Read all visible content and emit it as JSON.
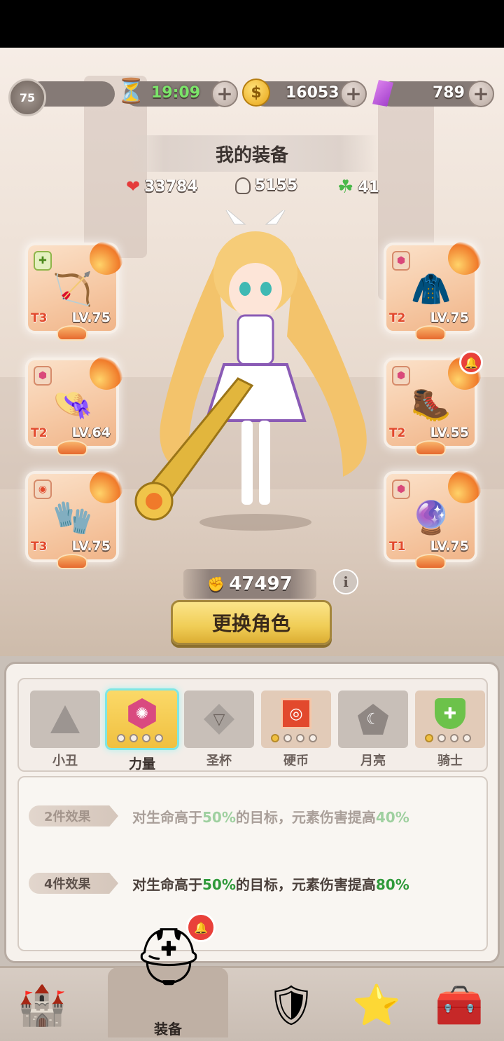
{
  "player": {
    "level": "75"
  },
  "resources": {
    "timer": "19:09",
    "coins": "16053",
    "gems": "789"
  },
  "page_title": "我的装备",
  "stats": {
    "hp": "33784",
    "attack": "5155",
    "luck": "41"
  },
  "equipment": {
    "left": [
      {
        "icon": "crossbow",
        "tier": "T3",
        "level": "LV.75"
      },
      {
        "icon": "feathered-hat",
        "tier": "T2",
        "level": "LV.64"
      },
      {
        "icon": "gauntlet",
        "tier": "T3",
        "level": "LV.75"
      }
    ],
    "right": [
      {
        "icon": "cloak",
        "tier": "T2",
        "level": "LV.75"
      },
      {
        "icon": "armored-boots",
        "tier": "T2",
        "level": "LV.55",
        "alert": true
      },
      {
        "icon": "crystal-amulet",
        "tier": "T1",
        "level": "LV.75"
      }
    ]
  },
  "combat_power": "47497",
  "switch_button": "更换角色",
  "set_tabs": [
    {
      "label": "小丑",
      "icon": "drop-triangle"
    },
    {
      "label": "力量",
      "icon": "pink-hexagon",
      "active": true,
      "dots": 4
    },
    {
      "label": "圣杯",
      "icon": "chalice-diamond"
    },
    {
      "label": "硬币",
      "icon": "red-square",
      "dots": 4,
      "dots_on": 1
    },
    {
      "label": "月亮",
      "icon": "moon-pentagon"
    },
    {
      "label": "骑士",
      "icon": "green-shield",
      "dots": 4,
      "dots_on": 1
    }
  ],
  "effects": [
    {
      "tag": "2件效果",
      "prefix": "对生命高于",
      "v1": "50%",
      "middle": "的目标，元素伤害提高",
      "v2": "40%",
      "active": false
    },
    {
      "tag": "4件效果",
      "prefix": "对生命高于",
      "v1": "50%",
      "middle": "的目标，元素伤害提高",
      "v2": "80%",
      "active": true
    }
  ],
  "nav": {
    "active_label": "装备"
  },
  "colors": {
    "accent_gold": "#f0c040",
    "highlight_green": "#2f9a3a",
    "alert_red": "#e9413a"
  }
}
